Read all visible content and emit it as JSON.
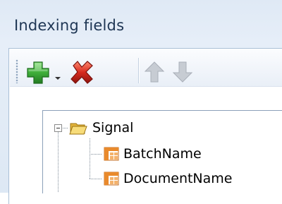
{
  "panel": {
    "title": "Indexing fields"
  },
  "toolbar": {
    "add": {
      "icon": "plus-icon",
      "has_dropdown": true
    },
    "delete": {
      "icon": "red-x-icon"
    },
    "move_up": {
      "icon": "arrow-up-icon",
      "enabled": false
    },
    "move_down": {
      "icon": "arrow-down-icon",
      "enabled": false
    }
  },
  "tree": {
    "root": {
      "label": "Signal",
      "icon": "folder-icon",
      "expanded": true
    },
    "children": [
      {
        "label": "BatchName",
        "icon": "field-icon"
      },
      {
        "label": "DocumentName",
        "icon": "field-icon"
      }
    ]
  },
  "colors": {
    "add_green": "#3fae3a",
    "delete_red": "#d62a1e",
    "disabled_gray": "#b9bec6",
    "folder_yellow": "#f2c94c",
    "field_orange": "#e98a2c"
  }
}
